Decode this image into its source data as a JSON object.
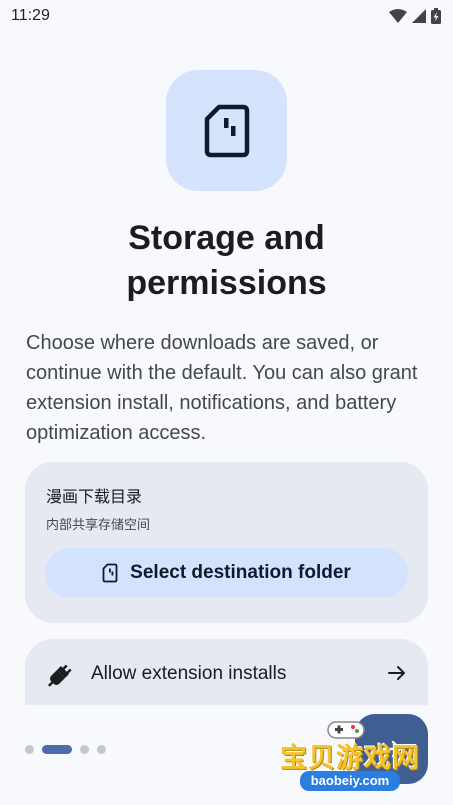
{
  "status_bar": {
    "time": "11:29",
    "icons": [
      "wifi-icon",
      "cellular-icon",
      "battery-charging-icon"
    ]
  },
  "hero": {
    "icon": "sd-card-icon",
    "title_line1": "Storage and",
    "title_line2": "permissions",
    "description": "Choose where downloads are saved, or continue with the default. You can also grant extension install, notifications, and battery optimization access."
  },
  "folder_card": {
    "title": "漫画下载目录",
    "subtitle": "内部共享存储空间",
    "button_icon": "sd-card-icon",
    "button_label": "Select destination folder"
  },
  "extension_card": {
    "icon": "extension-plug-icon",
    "label": "Allow extension installs",
    "arrow": "arrow-right-icon"
  },
  "pager": {
    "page_count": 4,
    "current_page": 1
  },
  "fab": {
    "icon": "arrow-right-icon"
  },
  "watermark": {
    "text": "宝贝游戏网",
    "url": "baobeiy.com"
  },
  "colors": {
    "background": "#f8f9fd",
    "card": "#e6e9f1",
    "accent_light": "#d3e3fd",
    "accent": "#3f5f93"
  }
}
